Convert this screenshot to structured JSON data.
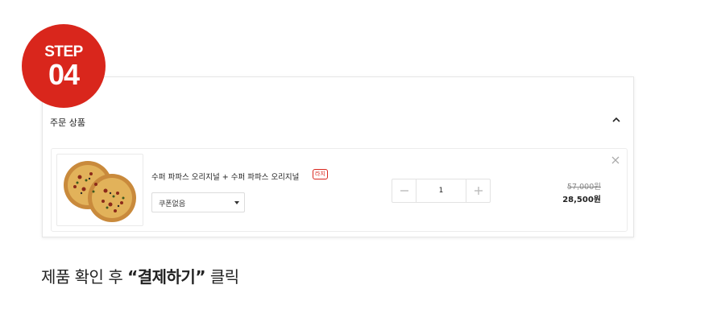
{
  "step": {
    "label": "STEP",
    "number": "04"
  },
  "order": {
    "section_title": "주문 상품",
    "item": {
      "name": "수퍼 파파스 오리지널 + 수퍼 파파스 오리지널",
      "size_badge": "라지",
      "coupon_selected": "쿠폰없음",
      "quantity": "1",
      "price_original": "57,000원",
      "price_sale": "28,500원"
    }
  },
  "caption": {
    "prefix": "제품 확인 후 ",
    "highlight": "“결제하기”",
    "suffix": " 클릭"
  },
  "colors": {
    "accent": "#d9261c"
  },
  "icons": [
    "chevron-up-icon",
    "close-icon",
    "minus-icon",
    "plus-icon",
    "caret-down-icon"
  ]
}
